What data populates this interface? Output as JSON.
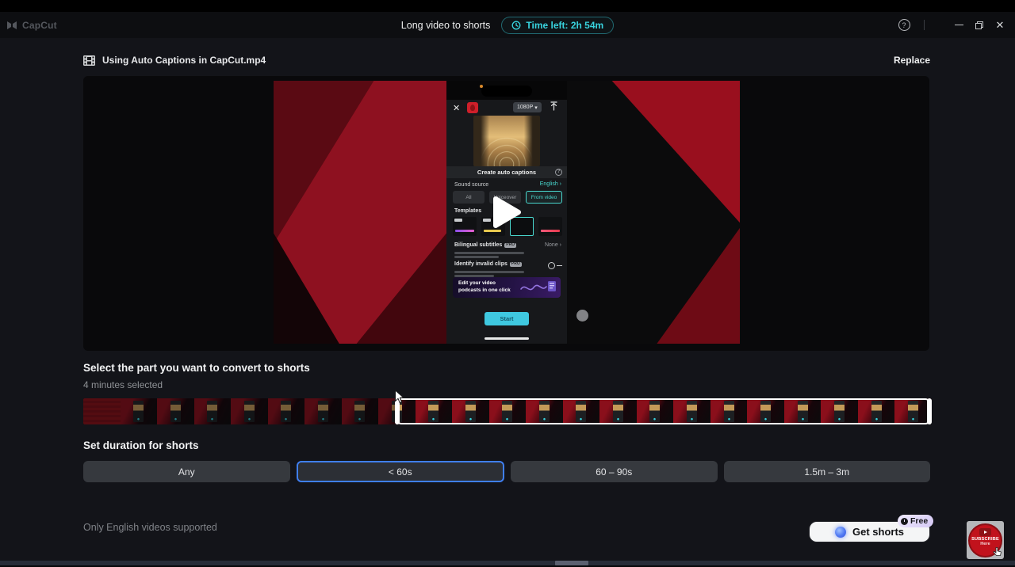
{
  "titlebar": {
    "app_name": "CapCut",
    "window_title": "Long video to shorts",
    "time_left": "Time left: 2h 54m",
    "accent_teal": "#38d3de"
  },
  "file_row": {
    "filename": "Using Auto Captions in CapCut.mp4",
    "replace_label": "Replace"
  },
  "preview": {
    "phone": {
      "resolution_chip": "1080P",
      "sheet_title": "Create auto captions",
      "sound_source_label": "Sound source",
      "language_value": "English",
      "chips": [
        "All",
        "Voiceover",
        "From video"
      ],
      "selected_chip": "From video",
      "templates_label": "Templates",
      "pro_badge": "PRO",
      "bilingual_label": "Bilingual subtitles",
      "bilingual_value": "None",
      "invalid_clips_label": "Identify invalid clips",
      "banner_text": "Edit your video podcasts in one click",
      "start_label": "Start"
    }
  },
  "select_section": {
    "heading": "Select the part you want to convert to shorts",
    "selected_info": "4 minutes selected"
  },
  "duration_section": {
    "heading": "Set duration for shorts",
    "options": [
      {
        "label": "Any",
        "selected": false
      },
      {
        "label": "< 60s",
        "selected": true
      },
      {
        "label": "60 – 90s",
        "selected": false
      },
      {
        "label": "1.5m – 3m",
        "selected": false
      }
    ],
    "selected_border_color": "#3f7ff2"
  },
  "footer": {
    "note": "Only English videos supported",
    "get_shorts_label": "Get shorts",
    "free_badge": "Free"
  },
  "sticker": {
    "line1": "SUBSCRIBE",
    "line2": "Here"
  },
  "timeline": {
    "cell_count": 23,
    "selection_start_ratio": 0.37
  }
}
